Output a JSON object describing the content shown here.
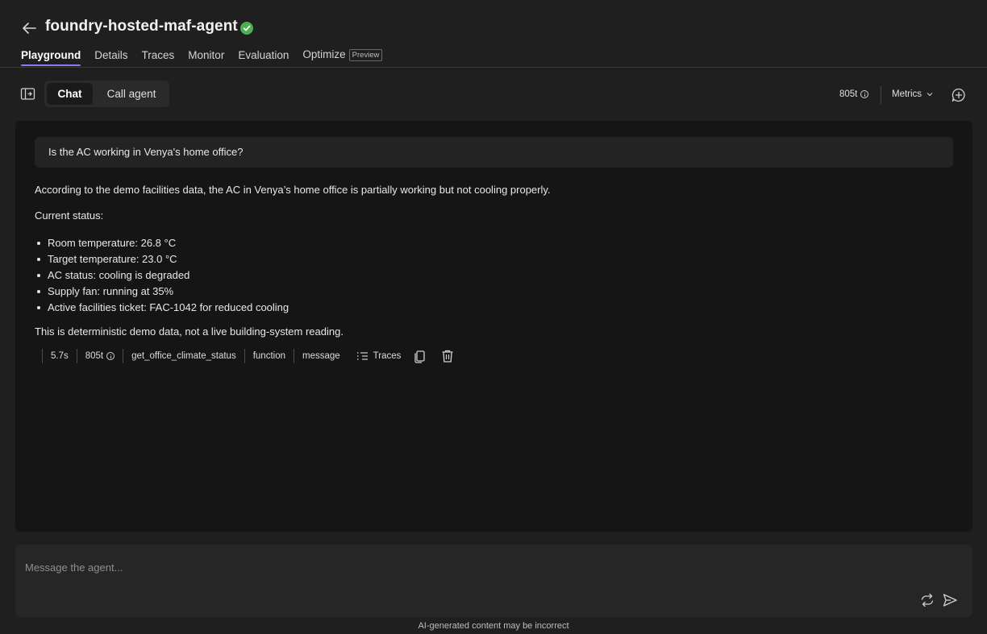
{
  "header": {
    "title": "foundry-hosted-maf-agent",
    "back_icon": "arrow-left-icon",
    "status_icon": "check-circle-icon",
    "tabs": [
      {
        "label": "Playground",
        "active": true
      },
      {
        "label": "Details"
      },
      {
        "label": "Traces"
      },
      {
        "label": "Monitor"
      },
      {
        "label": "Evaluation"
      },
      {
        "label": "Optimize",
        "badge": "Preview"
      }
    ]
  },
  "toolbar": {
    "chat_label": "Chat",
    "call_agent_label": "Call agent",
    "tokens": "805t",
    "metrics_label": "Metrics"
  },
  "chat": {
    "user_message": "Is the AC working in Venya's home office?",
    "reply_intro": "According to the demo facilities data, the AC in Venya’s home office is partially working but not cooling properly.",
    "status_heading": "Current status:",
    "status_items": [
      "Room temperature: 26.8 °C",
      "Target temperature: 23.0 °C",
      "AC status: cooling is degraded",
      "Supply fan: running at 35%",
      "Active facilities ticket: FAC-1042 for reduced cooling"
    ],
    "reply_footer": "This is deterministic demo data, not a live building-system reading.",
    "meta": {
      "duration": "5.7s",
      "tokens": "805t",
      "tool_name": "get_office_climate_status",
      "type": "function",
      "kind": "message",
      "traces_label": "Traces"
    }
  },
  "composer": {
    "placeholder": "Message the agent...",
    "disclaimer": "AI-generated content may be incorrect"
  },
  "colors": {
    "accent": "#8a7cf0",
    "success": "#4caf50",
    "background": "#1f1f1f",
    "panel": "#151515"
  }
}
